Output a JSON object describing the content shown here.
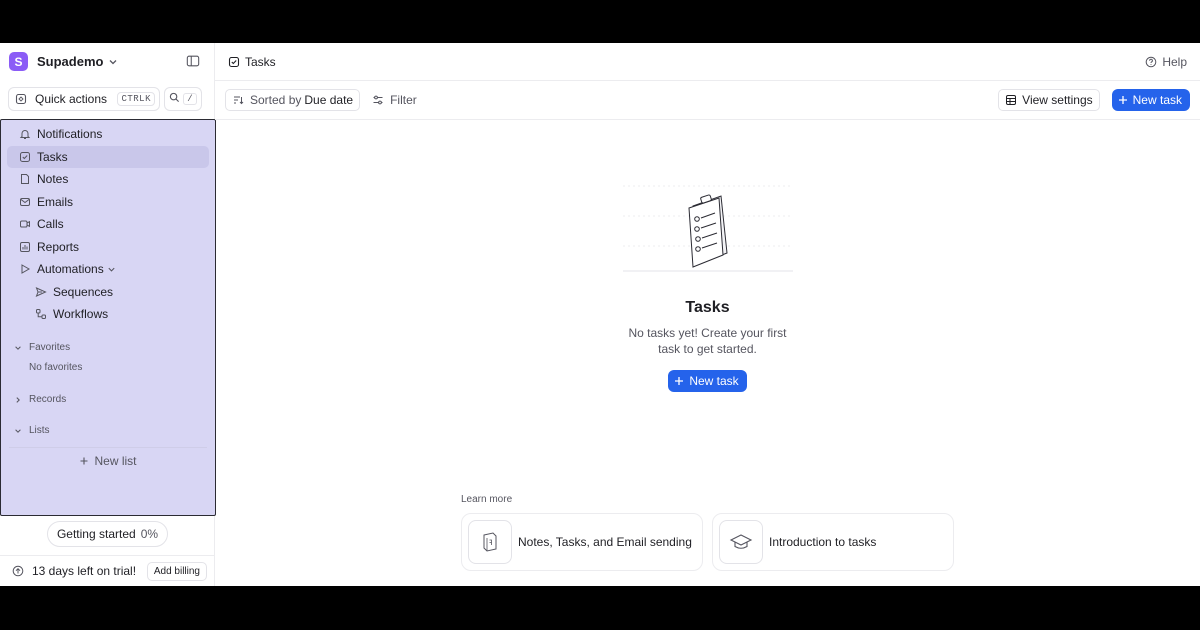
{
  "workspace": {
    "initial": "S",
    "name": "Supademo"
  },
  "quick_actions": {
    "label": "Quick actions",
    "shortcut": "CTRLK",
    "search_shortcut": "/"
  },
  "nav": {
    "items": [
      {
        "label": "Notifications"
      },
      {
        "label": "Tasks"
      },
      {
        "label": "Notes"
      },
      {
        "label": "Emails"
      },
      {
        "label": "Calls"
      },
      {
        "label": "Reports"
      },
      {
        "label": "Automations"
      }
    ],
    "sub_items": [
      {
        "label": "Sequences"
      },
      {
        "label": "Workflows"
      }
    ],
    "favorites": {
      "label": "Favorites",
      "empty": "No favorites"
    },
    "records": {
      "label": "Records"
    },
    "lists": {
      "label": "Lists",
      "new_list": "New list"
    }
  },
  "getting_started": {
    "label": "Getting started",
    "percent": "0%"
  },
  "trial": {
    "text": "13 days left on trial!",
    "billing": "Add billing"
  },
  "header": {
    "title": "Tasks",
    "help": "Help"
  },
  "toolbar": {
    "sorted_prefix": "Sorted by",
    "sorted_value": "Due date",
    "filter": "Filter",
    "view_settings": "View settings",
    "new_task": "New task"
  },
  "empty_state": {
    "title": "Tasks",
    "subtitle": "No tasks yet! Create your first task to get started.",
    "button": "New task"
  },
  "learn_more": {
    "label": "Learn more",
    "cards": [
      {
        "label": "Notes, Tasks, and Email sending"
      },
      {
        "label": "Introduction to tasks"
      }
    ]
  },
  "colors": {
    "accent": "#2563eb",
    "workspace": "#8b5cf6",
    "sidebar_highlight": "#d8d6f4"
  }
}
